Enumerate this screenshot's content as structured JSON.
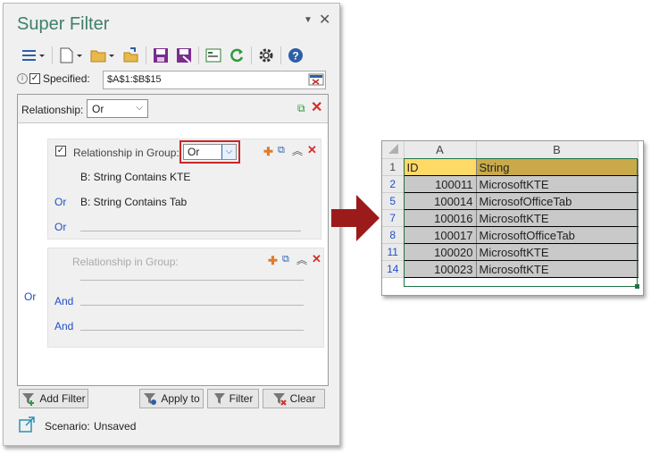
{
  "pane": {
    "title": "Super Filter",
    "specified_label": "Specified:",
    "range_value": "$A$1:$B$15",
    "relationship_label": "Relationship:",
    "relationship_value": "Or",
    "group1": {
      "label": "Relationship in Group:",
      "value": "Or",
      "conditions": [
        {
          "connector": "",
          "text": "B: String  Contains  KTE"
        },
        {
          "connector": "Or",
          "text": "B: String  Contains  Tab"
        },
        {
          "connector": "Or",
          "text": ""
        }
      ]
    },
    "outer_connector": "Or",
    "group2": {
      "label": "Relationship in Group:",
      "connectors": [
        "",
        "And",
        "And"
      ]
    },
    "buttons": {
      "add_filter": "Add Filter",
      "apply_to": "Apply to",
      "filter": "Filter",
      "clear": "Clear"
    },
    "scenario_label": "Scenario:",
    "scenario_value": "Unsaved"
  },
  "sheet": {
    "columns": [
      "A",
      "B"
    ],
    "header_row": {
      "row": "1",
      "a": "ID",
      "b": "String"
    },
    "rows": [
      {
        "row": "2",
        "a": "100011",
        "b": "MicrosoftKTE"
      },
      {
        "row": "5",
        "a": "100014",
        "b": "MicrosofOfficeTab"
      },
      {
        "row": "7",
        "a": "100016",
        "b": "MicrosoftKTE"
      },
      {
        "row": "8",
        "a": "100017",
        "b": "MicrosoftOfficeTab"
      },
      {
        "row": "11",
        "a": "100020",
        "b": "MicrosoftKTE"
      },
      {
        "row": "14",
        "a": "100023",
        "b": "MicrosoftKTE"
      }
    ]
  },
  "colors": {
    "title": "#3f7f6a",
    "arrow": "#9b1b1b",
    "connector": "#1f4fc7",
    "header_cell": "#ffd966",
    "data_cell": "#c9c9c9"
  }
}
